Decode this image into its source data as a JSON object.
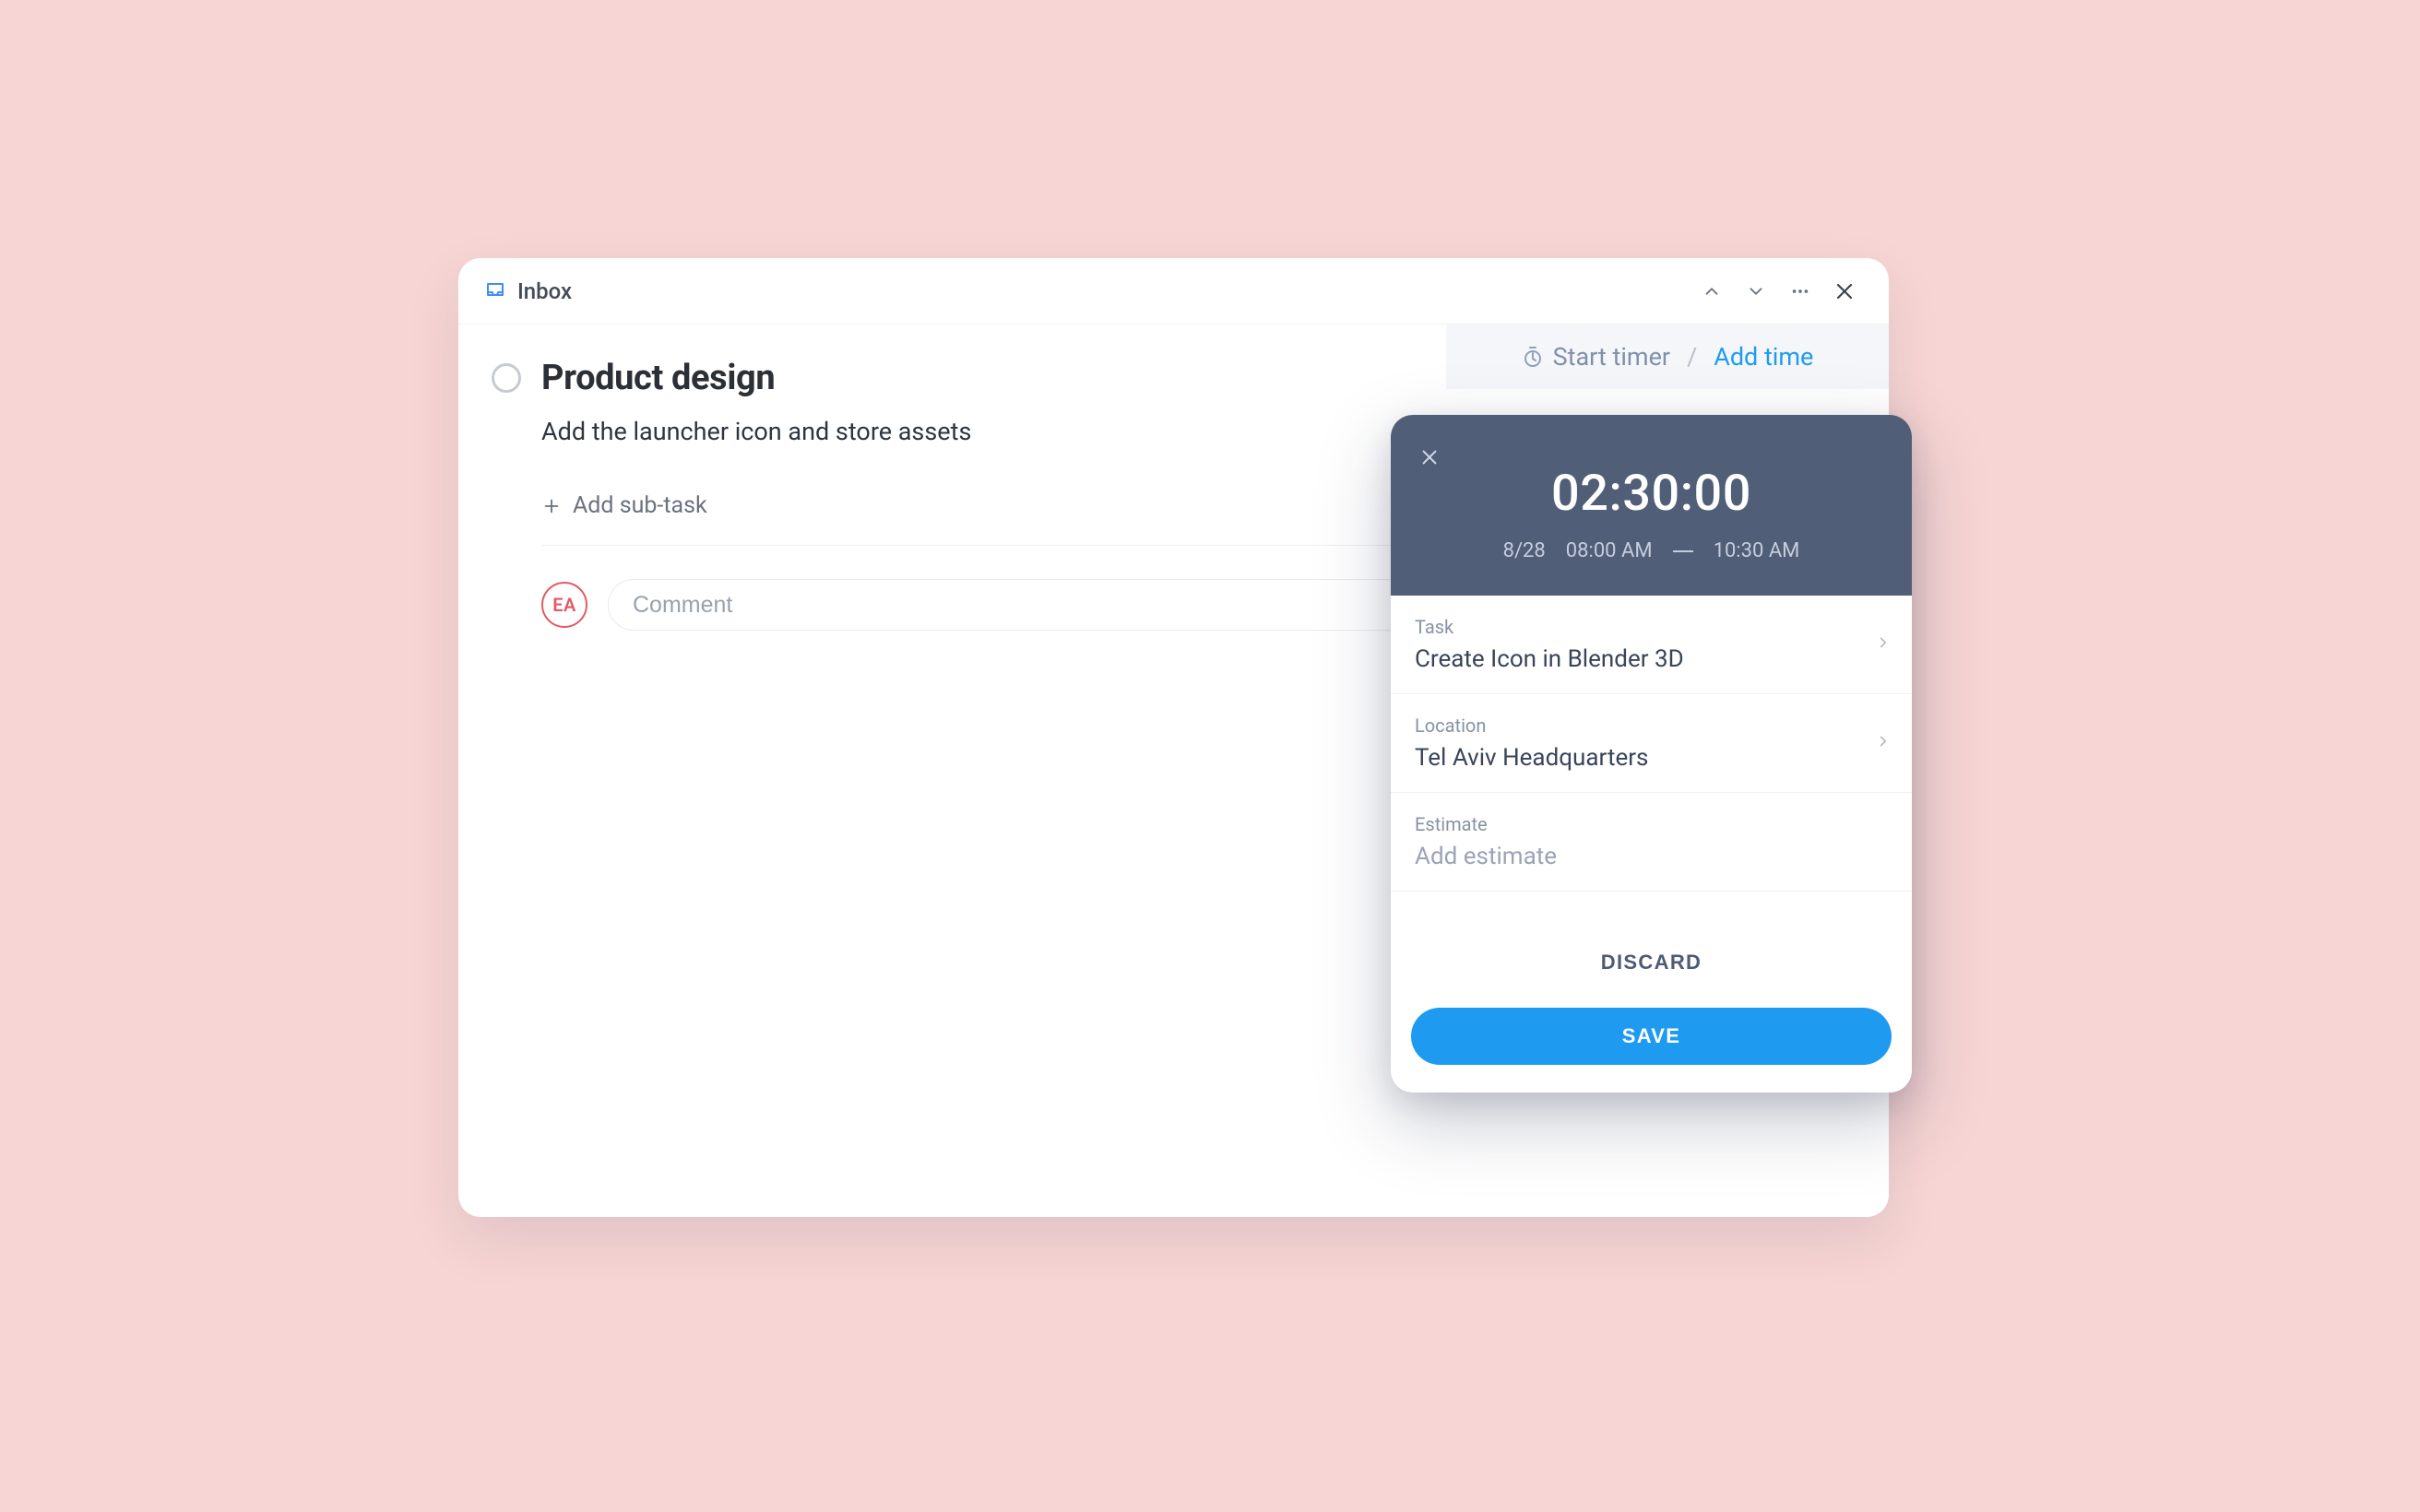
{
  "header": {
    "breadcrumb": "Inbox"
  },
  "task": {
    "title": "Product design",
    "description": "Add the launcher icon and store assets",
    "add_subtask_label": "Add sub-task",
    "comment_placeholder": "Comment",
    "avatar_initials": "EA"
  },
  "timer_bar": {
    "start_label": "Start timer",
    "add_label": "Add time",
    "separator": "/"
  },
  "time_popover": {
    "duration": "02:30:00",
    "date": "8/28",
    "start_time": "08:00 AM",
    "end_time": "10:30 AM",
    "task": {
      "label": "Task",
      "value": "Create Icon in Blender 3D"
    },
    "location": {
      "label": "Location",
      "value": "Tel Aviv Headquarters"
    },
    "estimate": {
      "label": "Estimate",
      "placeholder": "Add estimate"
    },
    "discard_label": "DISCARD",
    "save_label": "SAVE"
  }
}
